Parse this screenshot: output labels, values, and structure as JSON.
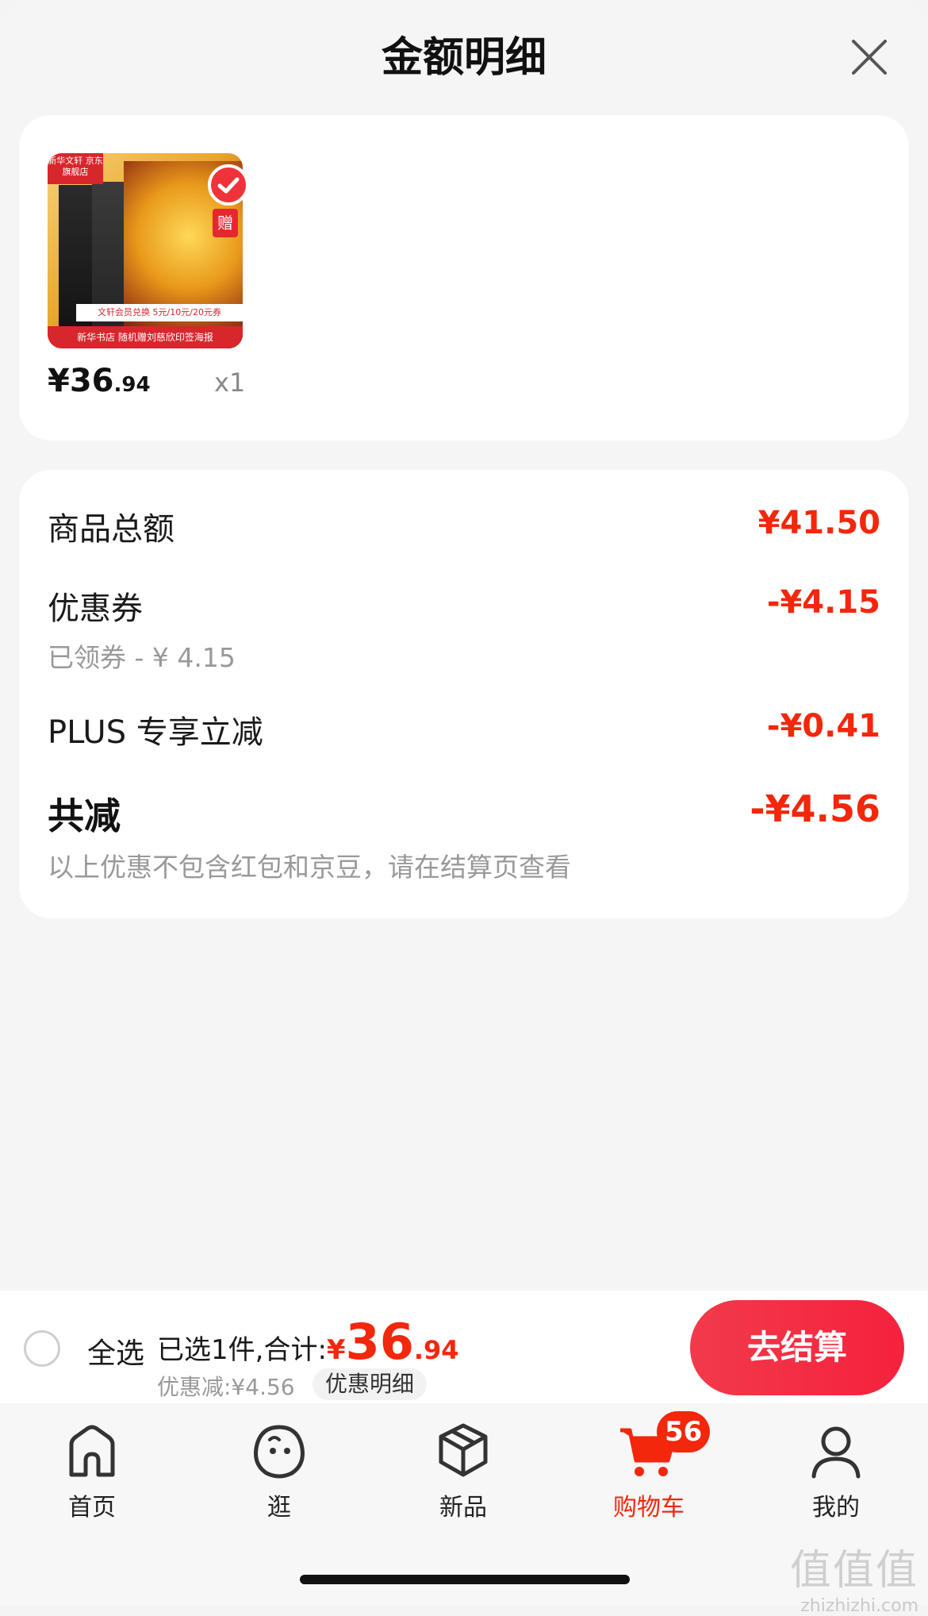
{
  "header": {
    "title": "金额明细"
  },
  "product": {
    "thumb_tag": "新华文轩 京东旗舰店",
    "thumb_banner": "文轩会员兑换 5元/10元/20元券",
    "thumb_strip": "新华书店 随机赠刘慈欣印签海报",
    "thumb_gift": "赠",
    "price_int": "¥36",
    "price_dec": ".94",
    "quantity": "x1"
  },
  "detail": {
    "rows": [
      {
        "label": "商品总额",
        "value": "¥41.50"
      },
      {
        "label": "优惠券",
        "value": "-¥4.15",
        "sub": "已领券 - ¥ 4.15"
      },
      {
        "label": "PLUS 专享立减",
        "value": "-¥0.41"
      }
    ],
    "total": {
      "label": "共减",
      "value": "-¥4.56"
    },
    "note": "以上优惠不包含红包和京豆，请在结算页查看"
  },
  "bottom_bar": {
    "select_all": "全选",
    "summary_prefix": "已选1件,合计:",
    "total_symbol": "¥",
    "total_int": "36",
    "total_dec": ".94",
    "discount": "优惠减:¥4.56",
    "detail_link": "优惠明细",
    "checkout": "去结算"
  },
  "tabbar": {
    "items": [
      {
        "label": "首页",
        "icon": "home-icon"
      },
      {
        "label": "逛",
        "icon": "discover-icon"
      },
      {
        "label": "新品",
        "icon": "new-products-icon"
      },
      {
        "label": "购物车",
        "icon": "cart-icon",
        "active": true
      },
      {
        "label": "我的",
        "icon": "profile-icon"
      }
    ],
    "cart_badge": "56"
  },
  "watermark": {
    "text": "值值值",
    "url": "zhizhizhi.com"
  },
  "colors": {
    "accent": "#f2270c",
    "checkout": "#f5213d"
  }
}
